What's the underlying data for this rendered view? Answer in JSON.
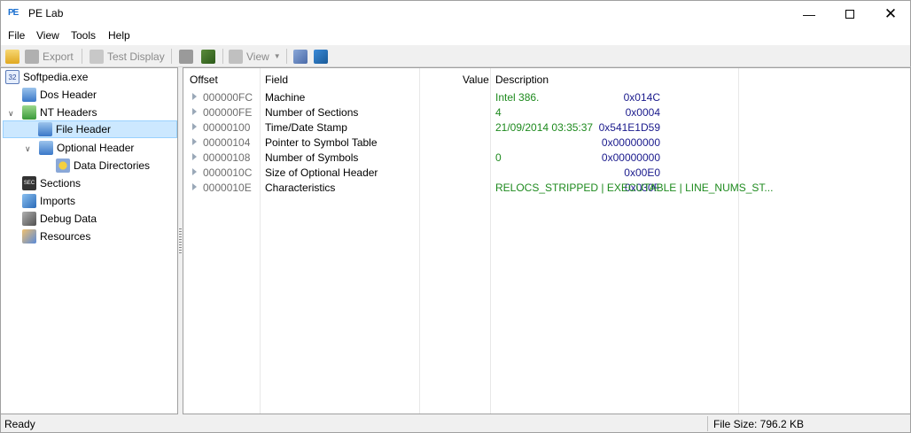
{
  "window": {
    "title": "PE Lab",
    "app_icon_text": "PE"
  },
  "menu": [
    "File",
    "View",
    "Tools",
    "Help"
  ],
  "toolbar": {
    "export_label": "Export",
    "test_display_label": "Test Display",
    "view_label": "View"
  },
  "tree": {
    "root": "Softpedia.exe",
    "root_icon_text": "32",
    "dos_header": "Dos Header",
    "nt_headers": "NT Headers",
    "file_header": "File Header",
    "optional_header": "Optional Header",
    "data_directories": "Data Directories",
    "sections": "Sections",
    "sections_icon_text": "SEC",
    "imports": "Imports",
    "debug_data": "Debug Data",
    "resources": "Resources"
  },
  "columns": {
    "offset": "Offset",
    "field": "Field",
    "value": "Value",
    "description": "Description"
  },
  "rows": [
    {
      "offset": "000000FC",
      "field": "Machine",
      "value": "0x014C",
      "description": "Intel 386."
    },
    {
      "offset": "000000FE",
      "field": "Number of Sections",
      "value": "0x0004",
      "description": "4"
    },
    {
      "offset": "00000100",
      "field": "Time/Date Stamp",
      "value": "0x541E1D59",
      "description": "21/09/2014 03:35:37"
    },
    {
      "offset": "00000104",
      "field": "Pointer to Symbol Table",
      "value": "0x00000000",
      "description": ""
    },
    {
      "offset": "00000108",
      "field": "Number of Symbols",
      "value": "0x00000000",
      "description": "0"
    },
    {
      "offset": "0000010C",
      "field": "Size of Optional Header",
      "value": "0x00E0",
      "description": ""
    },
    {
      "offset": "0000010E",
      "field": "Characteristics",
      "value": "0x030F",
      "description": "RELOCS_STRIPPED | EXECUTABLE | LINE_NUMS_ST..."
    }
  ],
  "status": {
    "left": "Ready",
    "file_size": "File Size: 796.2 KB"
  },
  "colors": {
    "offset": "#6d6d6d",
    "value": "#1a1a8c",
    "description": "#1e8a1e",
    "selection": "#cce8ff"
  }
}
